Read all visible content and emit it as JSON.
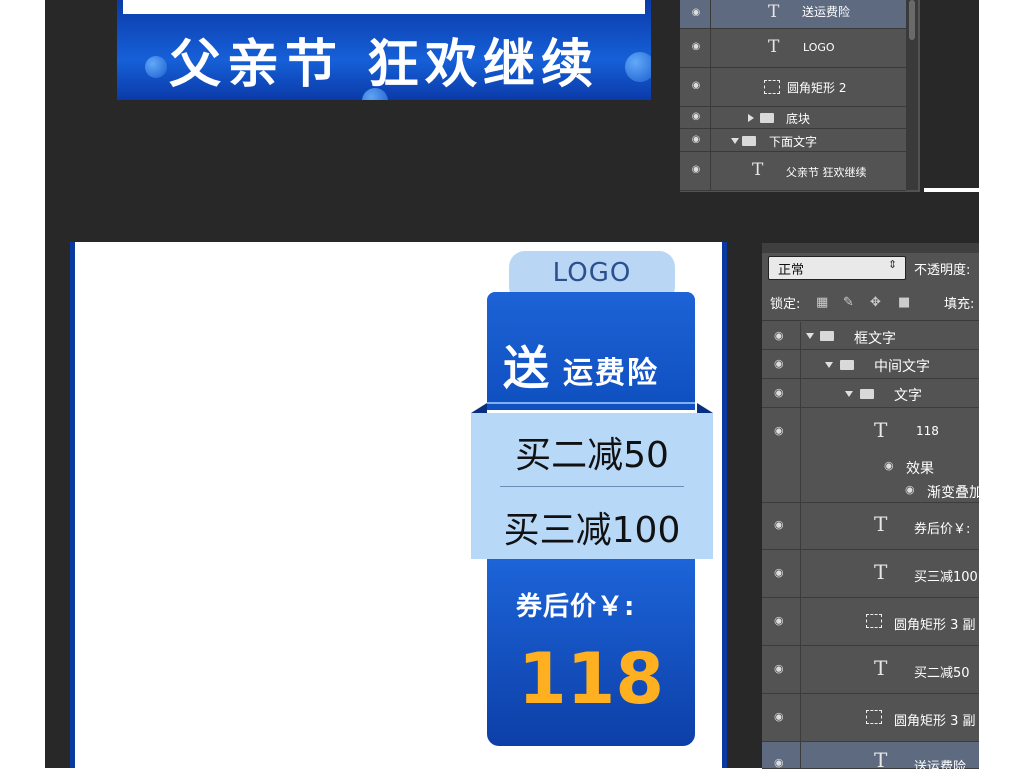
{
  "banner": {
    "text": "父亲节  狂欢继续"
  },
  "layers_top": {
    "rows": [
      {
        "label": "送运费险"
      },
      {
        "label": "LOGO"
      },
      {
        "label": "圆角矩形 2"
      },
      {
        "label": "底块"
      },
      {
        "label": "下面文字"
      },
      {
        "label": "父亲节  狂欢继续"
      }
    ]
  },
  "badge": {
    "logo": "LOGO",
    "title_big": "送",
    "title_small": "运费险",
    "deal1": "买二减50",
    "deal2": "买三减100",
    "price_label": "券后价￥:",
    "price": "118"
  },
  "panel": {
    "blend_mode": "正常",
    "opacity_label": "不透明度:",
    "lock_label": "锁定:",
    "fill_label": "填充:",
    "rows": [
      {
        "label": "框文字"
      },
      {
        "label": "中间文字"
      },
      {
        "label": "文字"
      },
      {
        "label": "118"
      },
      {
        "label": "效果"
      },
      {
        "label": "渐变叠加"
      },
      {
        "label": "券后价￥:"
      },
      {
        "label": "买三减100"
      },
      {
        "label": "圆角矩形 3 副"
      },
      {
        "label": "买二减50"
      },
      {
        "label": "圆角矩形 3 副"
      },
      {
        "label": "送运费险"
      }
    ]
  },
  "colors": {
    "accent_blue": "#0f4fc0",
    "price_orange": "#ffb020",
    "panel_bg": "#535353"
  }
}
